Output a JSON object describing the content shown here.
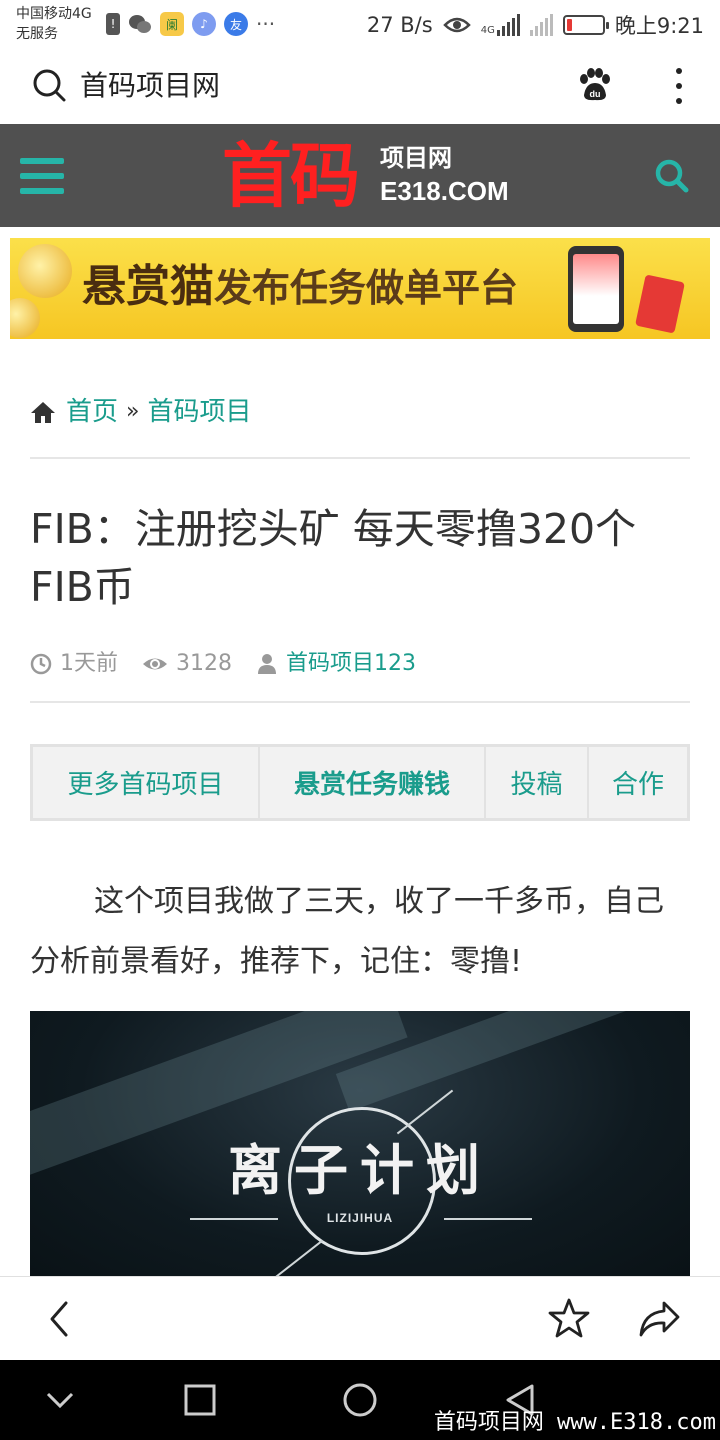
{
  "status_bar": {
    "carrier_line1": "中国移动4G",
    "carrier_line2": "无服务",
    "left_icons": [
      "alert-icon",
      "wechat-icon",
      "app-icon",
      "music-icon",
      "browser-icon",
      "more-dots-icon"
    ],
    "more_dots": "···",
    "net_speed": "27 B/s",
    "network_label": "4G",
    "time": "晚上9:21",
    "battery_color": "#e53935"
  },
  "browser_bar": {
    "title": "首码项目网"
  },
  "site_header": {
    "logo_main": "首码",
    "logo_sub1": "项目网",
    "logo_sub2": "E318.COM",
    "accent_color": "#26b5a8",
    "logo_color": "#ff2020"
  },
  "banner": {
    "text_big": "悬赏猫",
    "text_rest": "发布任务做单平台"
  },
  "breadcrumb": {
    "home": "首页",
    "separator": "»",
    "category": "首码项目"
  },
  "article": {
    "title": "FIB：注册挖头矿 每天零撸320个FIB币",
    "time_ago": "1天前",
    "views": "3128",
    "author": "首码项目123",
    "paragraph": "这个项目我做了三天，收了一千多币，自己分析前景看好，推荐下，记住：零撸!"
  },
  "tabs": [
    {
      "label": "更多首码项目",
      "bold": false
    },
    {
      "label": "悬赏任务赚钱",
      "bold": true
    },
    {
      "label": "投稿",
      "bold": false
    },
    {
      "label": "合作",
      "bold": false
    }
  ],
  "article_image": {
    "title": "离子计划",
    "subtitle": "LIZIJIHUA"
  },
  "watermark": "首码项目网 www.E318.com"
}
